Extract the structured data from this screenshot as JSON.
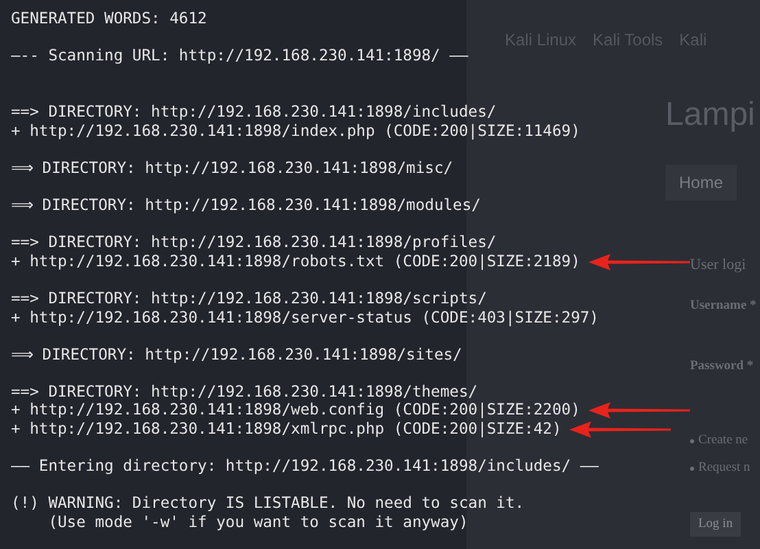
{
  "terminal": {
    "lines": [
      {
        "kind": "text",
        "text": "GENERATED WORDS: 4612",
        "arrow": false
      },
      {
        "kind": "blank"
      },
      {
        "kind": "text",
        "text": "—-- Scanning URL: http://192.168.230.141:1898/ ——",
        "arrow": false
      },
      {
        "kind": "blank"
      },
      {
        "kind": "blank"
      },
      {
        "kind": "text",
        "text": "==> DIRECTORY: http://192.168.230.141:1898/includes/",
        "arrow": false
      },
      {
        "kind": "text",
        "text": "+ http://192.168.230.141:1898/index.php (CODE:200|SIZE:11469)",
        "arrow": false
      },
      {
        "kind": "blank"
      },
      {
        "kind": "text",
        "text": "⟹ DIRECTORY: http://192.168.230.141:1898/misc/",
        "arrow": false
      },
      {
        "kind": "blank"
      },
      {
        "kind": "text",
        "text": "⟹ DIRECTORY: http://192.168.230.141:1898/modules/",
        "arrow": false
      },
      {
        "kind": "blank"
      },
      {
        "kind": "text",
        "text": "==> DIRECTORY: http://192.168.230.141:1898/profiles/",
        "arrow": false
      },
      {
        "kind": "text",
        "text": "+ http://192.168.230.141:1898/robots.txt (CODE:200|SIZE:2189)",
        "arrow": true
      },
      {
        "kind": "blank"
      },
      {
        "kind": "text",
        "text": "==> DIRECTORY: http://192.168.230.141:1898/scripts/",
        "arrow": false
      },
      {
        "kind": "text",
        "text": "+ http://192.168.230.141:1898/server-status (CODE:403|SIZE:297)",
        "arrow": false
      },
      {
        "kind": "blank"
      },
      {
        "kind": "text",
        "text": "⟹ DIRECTORY: http://192.168.230.141:1898/sites/",
        "arrow": false
      },
      {
        "kind": "blank"
      },
      {
        "kind": "text",
        "text": "==> DIRECTORY: http://192.168.230.141:1898/themes/",
        "arrow": false
      },
      {
        "kind": "text",
        "text": "+ http://192.168.230.141:1898/web.config (CODE:200|SIZE:2200)",
        "arrow": true
      },
      {
        "kind": "text",
        "text": "+ http://192.168.230.141:1898/xmlrpc.php (CODE:200|SIZE:42)",
        "arrow": true
      },
      {
        "kind": "blank"
      },
      {
        "kind": "text",
        "text": "—— Entering directory: http://192.168.230.141:1898/includes/ ——",
        "arrow": false
      },
      {
        "kind": "blank"
      },
      {
        "kind": "text",
        "text": "(!) WARNING: Directory IS LISTABLE. No need to scan it.",
        "arrow": false
      },
      {
        "kind": "text",
        "text": "    (Use mode '-w' if you want to scan it anyway)",
        "arrow": false
      }
    ]
  },
  "browser": {
    "bookmarks": [
      "Kali Linux",
      "Kali Tools",
      "Kali"
    ],
    "site_title": "Lampi",
    "nav": [
      "Home"
    ],
    "login": {
      "heading": "User logi",
      "fields": [
        "Username *",
        "Password *"
      ],
      "links": [
        "Create ne",
        "Request n"
      ],
      "button": "Log in"
    }
  }
}
